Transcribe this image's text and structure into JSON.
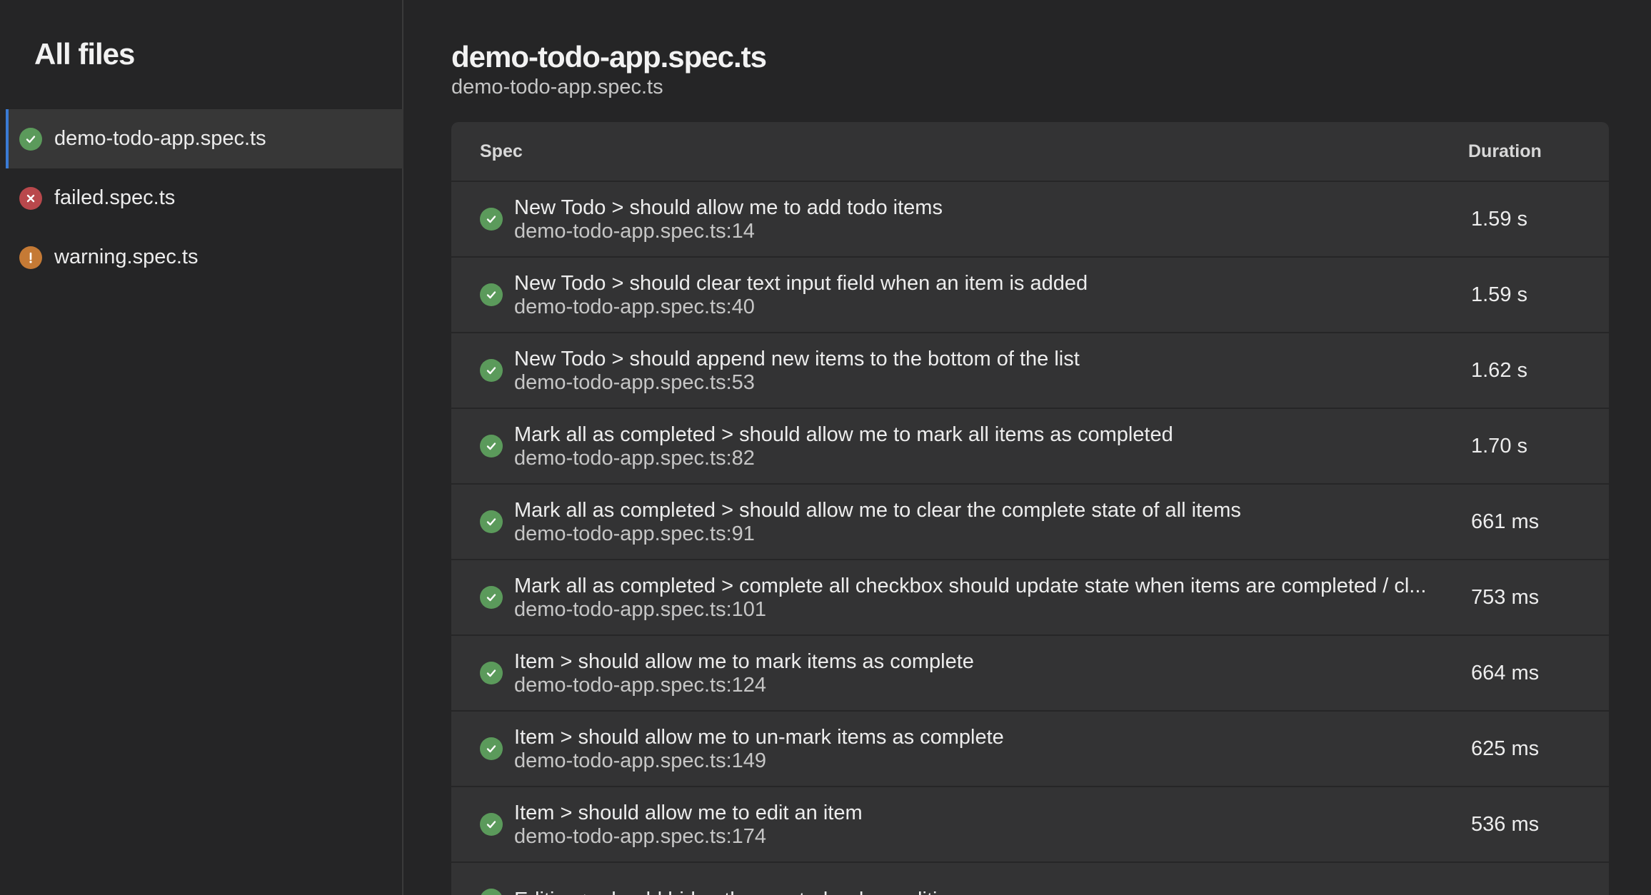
{
  "sidebar": {
    "title": "All files",
    "files": [
      {
        "name": "demo-todo-app.spec.ts",
        "status": "passed",
        "icon": "check-circle-icon",
        "active": true
      },
      {
        "name": "failed.spec.ts",
        "status": "failed",
        "icon": "x-circle-icon",
        "active": false
      },
      {
        "name": "warning.spec.ts",
        "status": "warning",
        "icon": "exclamation-circle-icon",
        "active": false
      }
    ]
  },
  "main": {
    "title": "demo-todo-app.spec.ts",
    "subtitle": "demo-todo-app.spec.ts",
    "table": {
      "headers": {
        "spec": "Spec",
        "duration": "Duration"
      },
      "rows": [
        {
          "title": "New Todo > should allow me to add todo items",
          "location": "demo-todo-app.spec.ts:14",
          "duration": "1.59 s",
          "status": "passed"
        },
        {
          "title": "New Todo > should clear text input field when an item is added",
          "location": "demo-todo-app.spec.ts:40",
          "duration": "1.59 s",
          "status": "passed"
        },
        {
          "title": "New Todo > should append new items to the bottom of the list",
          "location": "demo-todo-app.spec.ts:53",
          "duration": "1.62 s",
          "status": "passed"
        },
        {
          "title": "Mark all as completed > should allow me to mark all items as completed",
          "location": "demo-todo-app.spec.ts:82",
          "duration": "1.70 s",
          "status": "passed"
        },
        {
          "title": "Mark all as completed > should allow me to clear the complete state of all items",
          "location": "demo-todo-app.spec.ts:91",
          "duration": "661 ms",
          "status": "passed"
        },
        {
          "title": "Mark all as completed > complete all checkbox should update state when items are completed / cl...",
          "location": "demo-todo-app.spec.ts:101",
          "duration": "753 ms",
          "status": "passed"
        },
        {
          "title": "Item > should allow me to mark items as complete",
          "location": "demo-todo-app.spec.ts:124",
          "duration": "664 ms",
          "status": "passed"
        },
        {
          "title": "Item > should allow me to un-mark items as complete",
          "location": "demo-todo-app.spec.ts:149",
          "duration": "625 ms",
          "status": "passed"
        },
        {
          "title": "Item > should allow me to edit an item",
          "location": "demo-todo-app.spec.ts:174",
          "duration": "536 ms",
          "status": "passed"
        },
        {
          "title": "Editing > should hide other controls when editing",
          "location": "",
          "duration": "",
          "status": "passed"
        }
      ]
    }
  },
  "colors": {
    "background": "#252526",
    "panel": "#333334",
    "passed": "#5b9a5b",
    "failed": "#b9484c",
    "warning": "#c57a35",
    "active_accent": "#3a7bd5"
  }
}
